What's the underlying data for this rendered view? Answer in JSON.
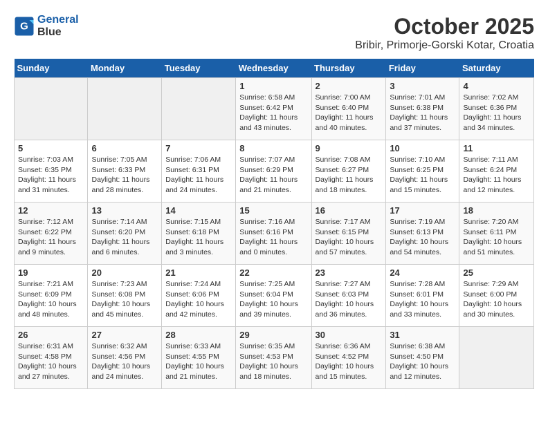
{
  "header": {
    "logo_line1": "General",
    "logo_line2": "Blue",
    "title": "October 2025",
    "subtitle": "Bribir, Primorje-Gorski Kotar, Croatia"
  },
  "days_of_week": [
    "Sunday",
    "Monday",
    "Tuesday",
    "Wednesday",
    "Thursday",
    "Friday",
    "Saturday"
  ],
  "weeks": [
    [
      {
        "num": "",
        "detail": ""
      },
      {
        "num": "",
        "detail": ""
      },
      {
        "num": "",
        "detail": ""
      },
      {
        "num": "1",
        "detail": "Sunrise: 6:58 AM\nSunset: 6:42 PM\nDaylight: 11 hours\nand 43 minutes."
      },
      {
        "num": "2",
        "detail": "Sunrise: 7:00 AM\nSunset: 6:40 PM\nDaylight: 11 hours\nand 40 minutes."
      },
      {
        "num": "3",
        "detail": "Sunrise: 7:01 AM\nSunset: 6:38 PM\nDaylight: 11 hours\nand 37 minutes."
      },
      {
        "num": "4",
        "detail": "Sunrise: 7:02 AM\nSunset: 6:36 PM\nDaylight: 11 hours\nand 34 minutes."
      }
    ],
    [
      {
        "num": "5",
        "detail": "Sunrise: 7:03 AM\nSunset: 6:35 PM\nDaylight: 11 hours\nand 31 minutes."
      },
      {
        "num": "6",
        "detail": "Sunrise: 7:05 AM\nSunset: 6:33 PM\nDaylight: 11 hours\nand 28 minutes."
      },
      {
        "num": "7",
        "detail": "Sunrise: 7:06 AM\nSunset: 6:31 PM\nDaylight: 11 hours\nand 24 minutes."
      },
      {
        "num": "8",
        "detail": "Sunrise: 7:07 AM\nSunset: 6:29 PM\nDaylight: 11 hours\nand 21 minutes."
      },
      {
        "num": "9",
        "detail": "Sunrise: 7:08 AM\nSunset: 6:27 PM\nDaylight: 11 hours\nand 18 minutes."
      },
      {
        "num": "10",
        "detail": "Sunrise: 7:10 AM\nSunset: 6:25 PM\nDaylight: 11 hours\nand 15 minutes."
      },
      {
        "num": "11",
        "detail": "Sunrise: 7:11 AM\nSunset: 6:24 PM\nDaylight: 11 hours\nand 12 minutes."
      }
    ],
    [
      {
        "num": "12",
        "detail": "Sunrise: 7:12 AM\nSunset: 6:22 PM\nDaylight: 11 hours\nand 9 minutes."
      },
      {
        "num": "13",
        "detail": "Sunrise: 7:14 AM\nSunset: 6:20 PM\nDaylight: 11 hours\nand 6 minutes."
      },
      {
        "num": "14",
        "detail": "Sunrise: 7:15 AM\nSunset: 6:18 PM\nDaylight: 11 hours\nand 3 minutes."
      },
      {
        "num": "15",
        "detail": "Sunrise: 7:16 AM\nSunset: 6:16 PM\nDaylight: 11 hours\nand 0 minutes."
      },
      {
        "num": "16",
        "detail": "Sunrise: 7:17 AM\nSunset: 6:15 PM\nDaylight: 10 hours\nand 57 minutes."
      },
      {
        "num": "17",
        "detail": "Sunrise: 7:19 AM\nSunset: 6:13 PM\nDaylight: 10 hours\nand 54 minutes."
      },
      {
        "num": "18",
        "detail": "Sunrise: 7:20 AM\nSunset: 6:11 PM\nDaylight: 10 hours\nand 51 minutes."
      }
    ],
    [
      {
        "num": "19",
        "detail": "Sunrise: 7:21 AM\nSunset: 6:09 PM\nDaylight: 10 hours\nand 48 minutes."
      },
      {
        "num": "20",
        "detail": "Sunrise: 7:23 AM\nSunset: 6:08 PM\nDaylight: 10 hours\nand 45 minutes."
      },
      {
        "num": "21",
        "detail": "Sunrise: 7:24 AM\nSunset: 6:06 PM\nDaylight: 10 hours\nand 42 minutes."
      },
      {
        "num": "22",
        "detail": "Sunrise: 7:25 AM\nSunset: 6:04 PM\nDaylight: 10 hours\nand 39 minutes."
      },
      {
        "num": "23",
        "detail": "Sunrise: 7:27 AM\nSunset: 6:03 PM\nDaylight: 10 hours\nand 36 minutes."
      },
      {
        "num": "24",
        "detail": "Sunrise: 7:28 AM\nSunset: 6:01 PM\nDaylight: 10 hours\nand 33 minutes."
      },
      {
        "num": "25",
        "detail": "Sunrise: 7:29 AM\nSunset: 6:00 PM\nDaylight: 10 hours\nand 30 minutes."
      }
    ],
    [
      {
        "num": "26",
        "detail": "Sunrise: 6:31 AM\nSunset: 4:58 PM\nDaylight: 10 hours\nand 27 minutes."
      },
      {
        "num": "27",
        "detail": "Sunrise: 6:32 AM\nSunset: 4:56 PM\nDaylight: 10 hours\nand 24 minutes."
      },
      {
        "num": "28",
        "detail": "Sunrise: 6:33 AM\nSunset: 4:55 PM\nDaylight: 10 hours\nand 21 minutes."
      },
      {
        "num": "29",
        "detail": "Sunrise: 6:35 AM\nSunset: 4:53 PM\nDaylight: 10 hours\nand 18 minutes."
      },
      {
        "num": "30",
        "detail": "Sunrise: 6:36 AM\nSunset: 4:52 PM\nDaylight: 10 hours\nand 15 minutes."
      },
      {
        "num": "31",
        "detail": "Sunrise: 6:38 AM\nSunset: 4:50 PM\nDaylight: 10 hours\nand 12 minutes."
      },
      {
        "num": "",
        "detail": ""
      }
    ]
  ]
}
